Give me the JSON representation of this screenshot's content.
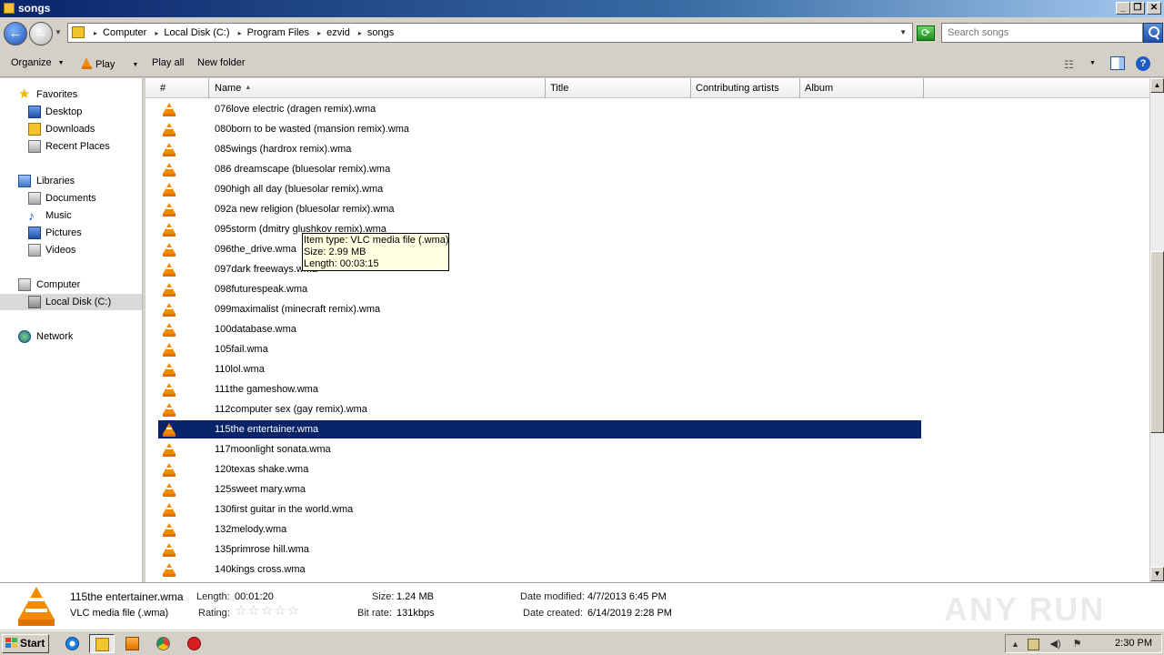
{
  "window": {
    "title": "songs",
    "min_label": "_",
    "max_label": "❐",
    "close_label": "✕"
  },
  "address": {
    "crumbs": [
      "Computer",
      "Local Disk (C:)",
      "Program Files",
      "ezvid",
      "songs"
    ],
    "search_placeholder": "Search songs"
  },
  "toolbar": {
    "organize": "Organize",
    "play": "Play",
    "play_all": "Play all",
    "new_folder": "New folder",
    "help": "?"
  },
  "sidebar": {
    "favorites": "Favorites",
    "desktop": "Desktop",
    "downloads": "Downloads",
    "recent": "Recent Places",
    "libraries": "Libraries",
    "documents": "Documents",
    "music": "Music",
    "pictures": "Pictures",
    "videos": "Videos",
    "computer": "Computer",
    "local_disk": "Local Disk (C:)",
    "network": "Network"
  },
  "columns": {
    "number": "#",
    "name": "Name",
    "title": "Title",
    "artists": "Contributing artists",
    "album": "Album"
  },
  "files": [
    "076love electric (dragen remix).wma",
    "080born to be wasted (mansion remix).wma",
    "085wings (hardrox remix).wma",
    "086 dreamscape (bluesolar remix).wma",
    "090high all day (bluesolar remix).wma",
    "092a new religion (bluesolar remix).wma",
    "095storm (dmitry glushkov remix).wma",
    "096the_drive.wma",
    "097dark freeways.wma",
    "098futurespeak.wma",
    "099maximalist (minecraft remix).wma",
    "100database.wma",
    "105fail.wma",
    "110lol.wma",
    "111the gameshow.wma",
    "112computer sex (gay remix).wma",
    "115the entertainer.wma",
    "117moonlight sonata.wma",
    "120texas shake.wma",
    "125sweet mary.wma",
    "130first guitar in the world.wma",
    "132melody.wma",
    "135primrose hill.wma",
    "140kings cross.wma"
  ],
  "selected_index": 16,
  "tooltip": {
    "line1": "Item type: VLC media file (.wma)",
    "line2": "Size: 2.99 MB",
    "line3": "Length: 00:03:15"
  },
  "details": {
    "filename": "115the entertainer.wma",
    "filetype": "VLC media file (.wma)",
    "length_label": "Length:",
    "length": "00:01:20",
    "rating_label": "Rating:",
    "rating_stars": "☆☆☆☆☆",
    "size_label": "Size:",
    "size": "1.24 MB",
    "bitrate_label": "Bit rate:",
    "bitrate": "131kbps",
    "modified_label": "Date modified:",
    "modified": "4/7/2013 6:45 PM",
    "created_label": "Date created:",
    "created": "6/14/2019 2:28 PM"
  },
  "watermark": "ANY RUN",
  "taskbar": {
    "start": "Start",
    "clock": "2:30 PM"
  },
  "colors": {
    "selection": "#0a246a",
    "vlc_orange": "#f08a00",
    "tooltip_bg": "#ffffe1"
  }
}
